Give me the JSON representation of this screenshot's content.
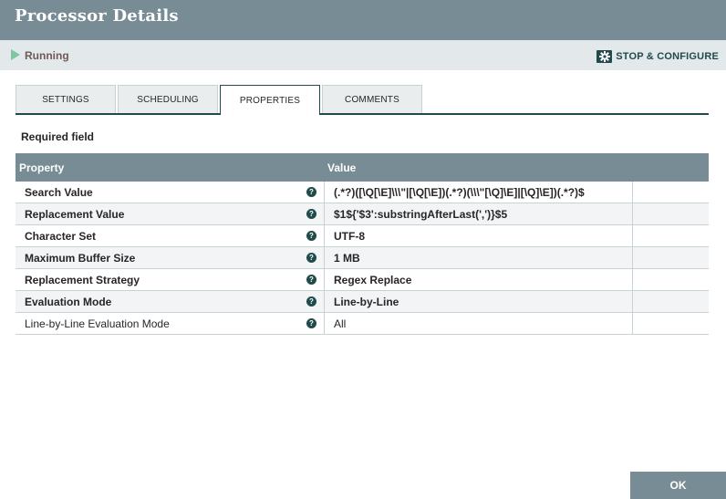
{
  "dialog": {
    "title": "Processor Details"
  },
  "status": {
    "icon": "play-icon",
    "label": "Running",
    "color": "#7dc7a0"
  },
  "actions": {
    "stop_configure_label": "STOP & CONFIGURE",
    "stop_configure_icon": "gear-icon",
    "ok_label": "OK"
  },
  "tabs": [
    {
      "label": "SETTINGS",
      "active": false
    },
    {
      "label": "SCHEDULING",
      "active": false
    },
    {
      "label": "PROPERTIES",
      "active": true
    },
    {
      "label": "COMMENTS",
      "active": false
    }
  ],
  "properties": {
    "required_note": "Required field",
    "columns": {
      "property": "Property",
      "value": "Value"
    },
    "help_icon": "question-circle-icon",
    "rows": [
      {
        "name": "Search Value",
        "value": "(.*?)([\\Q[\\E]\\\\\\\"|[\\Q[\\E])(.*?)(\\\\\\\"[\\Q]\\E]|[\\Q]\\E])(.*?)$",
        "required": true
      },
      {
        "name": "Replacement Value",
        "value": "$1${'$3':substringAfterLast(',')}$5",
        "required": true
      },
      {
        "name": "Character Set",
        "value": "UTF-8",
        "required": true
      },
      {
        "name": "Maximum Buffer Size",
        "value": "1 MB",
        "required": true
      },
      {
        "name": "Replacement Strategy",
        "value": "Regex Replace",
        "required": true
      },
      {
        "name": "Evaluation Mode",
        "value": "Line-by-Line",
        "required": true
      },
      {
        "name": "Line-by-Line Evaluation Mode",
        "value": "All",
        "required": false
      }
    ]
  },
  "colors": {
    "header": "#778c95",
    "accent": "#204a4c",
    "status_bar": "#e3e8eb"
  }
}
